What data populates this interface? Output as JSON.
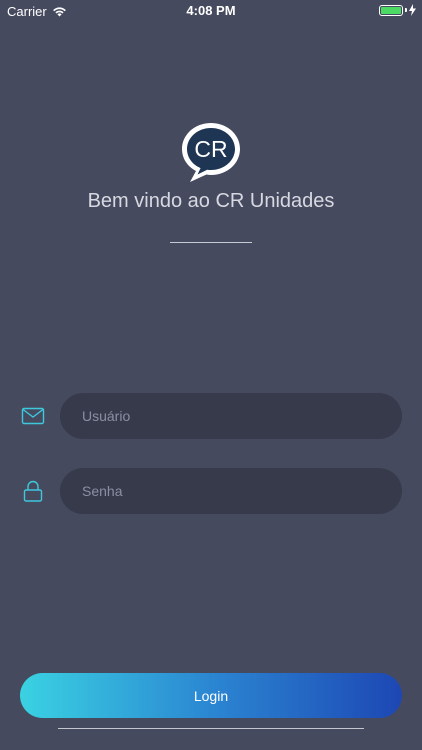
{
  "status_bar": {
    "carrier": "Carrier",
    "time": "4:08 PM",
    "battery_level": 1.0
  },
  "logo": {
    "text": "CR"
  },
  "welcome_text": "Bem vindo ao CR Unidades",
  "form": {
    "username": {
      "placeholder": "Usuário",
      "value": "",
      "icon": "envelope-icon"
    },
    "password": {
      "placeholder": "Senha",
      "value": "",
      "icon": "lock-icon"
    }
  },
  "login_button": {
    "label": "Login"
  },
  "colors": {
    "background": "#464a5e",
    "field_background": "#363a4b",
    "accent": "#3ec8dd",
    "gradient_start": "#3ad2e2",
    "gradient_end": "#1d47b4"
  }
}
